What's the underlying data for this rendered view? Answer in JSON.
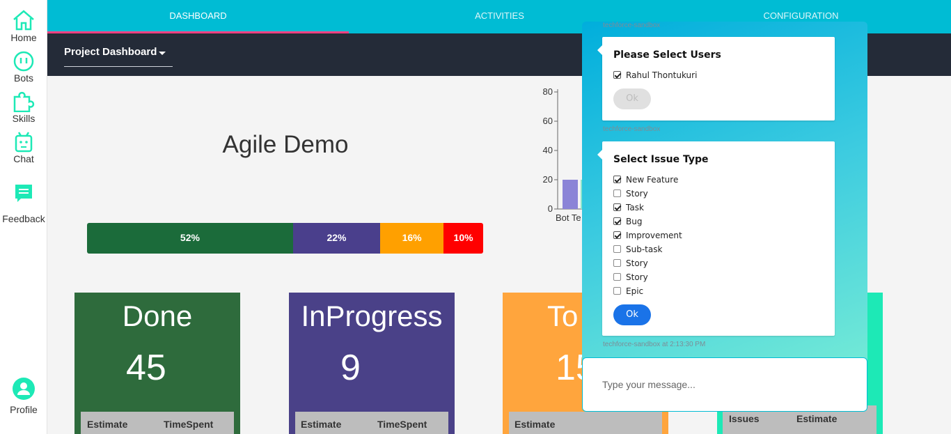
{
  "sidebar": {
    "items": [
      {
        "label": "Home",
        "icon": "home-icon"
      },
      {
        "label": "Bots",
        "icon": "bot-icon"
      },
      {
        "label": "Skills",
        "icon": "puzzle-icon"
      },
      {
        "label": "Chat",
        "icon": "robot-icon"
      },
      {
        "label": "Feedback",
        "icon": "feedback-icon"
      },
      {
        "label": "Profile",
        "icon": "profile-icon"
      }
    ]
  },
  "nav": {
    "tabs": [
      {
        "label": "DASHBOARD",
        "active": true
      },
      {
        "label": "ACTIVITIES",
        "active": false
      },
      {
        "label": "CONFIGURATION",
        "active": false
      }
    ]
  },
  "subheader": {
    "project_select": "Project Dashboard"
  },
  "main": {
    "title": "Agile Demo",
    "progress": [
      {
        "label": "52%",
        "value": 52,
        "color": "#1b6b3a"
      },
      {
        "label": "22%",
        "value": 22,
        "color": "#4a3f8c"
      },
      {
        "label": "16%",
        "value": 16,
        "color": "#ffa000"
      },
      {
        "label": "10%",
        "value": 10,
        "color": "#ff0000"
      }
    ]
  },
  "chart_fragment": {
    "y_ticks": [
      "0",
      "20",
      "40",
      "60",
      "80"
    ],
    "x_label_visible": "Bot Te",
    "bar_value": 20,
    "ylim": [
      0,
      80
    ]
  },
  "cards": [
    {
      "title": "Done",
      "count": "45",
      "col1": "Estimate",
      "col2": "TimeSpent",
      "color": "#2e6b3c"
    },
    {
      "title": "InProgress",
      "count": "9",
      "col1": "Estimate",
      "col2": "TimeSpent",
      "color": "#4a4188"
    },
    {
      "title": "To",
      "count": "15",
      "col1": "Estimate",
      "col2": "",
      "color": "#ffa53d"
    },
    {
      "title": "",
      "count": "",
      "col1": "Issues",
      "col2": "Estimate",
      "color": "#1de9b6"
    }
  ],
  "chat": {
    "meta_top": "techforce-sandbox",
    "meta_mid": "techforce-sandbox",
    "meta_bottom": "techforce-sandbox at 2:13:30 PM",
    "users_card": {
      "title": "Please Select Users",
      "options": [
        {
          "label": "Rahul Thontukuri",
          "checked": true
        }
      ],
      "ok": "Ok"
    },
    "issue_card": {
      "title": "Select Issue Type",
      "options": [
        {
          "label": "New Feature",
          "checked": true
        },
        {
          "label": "Story",
          "checked": false
        },
        {
          "label": "Task",
          "checked": true
        },
        {
          "label": "Bug",
          "checked": true
        },
        {
          "label": "Improvement",
          "checked": true
        },
        {
          "label": "Sub-task",
          "checked": false
        },
        {
          "label": "Story",
          "checked": false
        },
        {
          "label": "Story",
          "checked": false
        },
        {
          "label": "Epic",
          "checked": false
        }
      ],
      "ok": "Ok"
    },
    "input_placeholder": "Type your message..."
  }
}
